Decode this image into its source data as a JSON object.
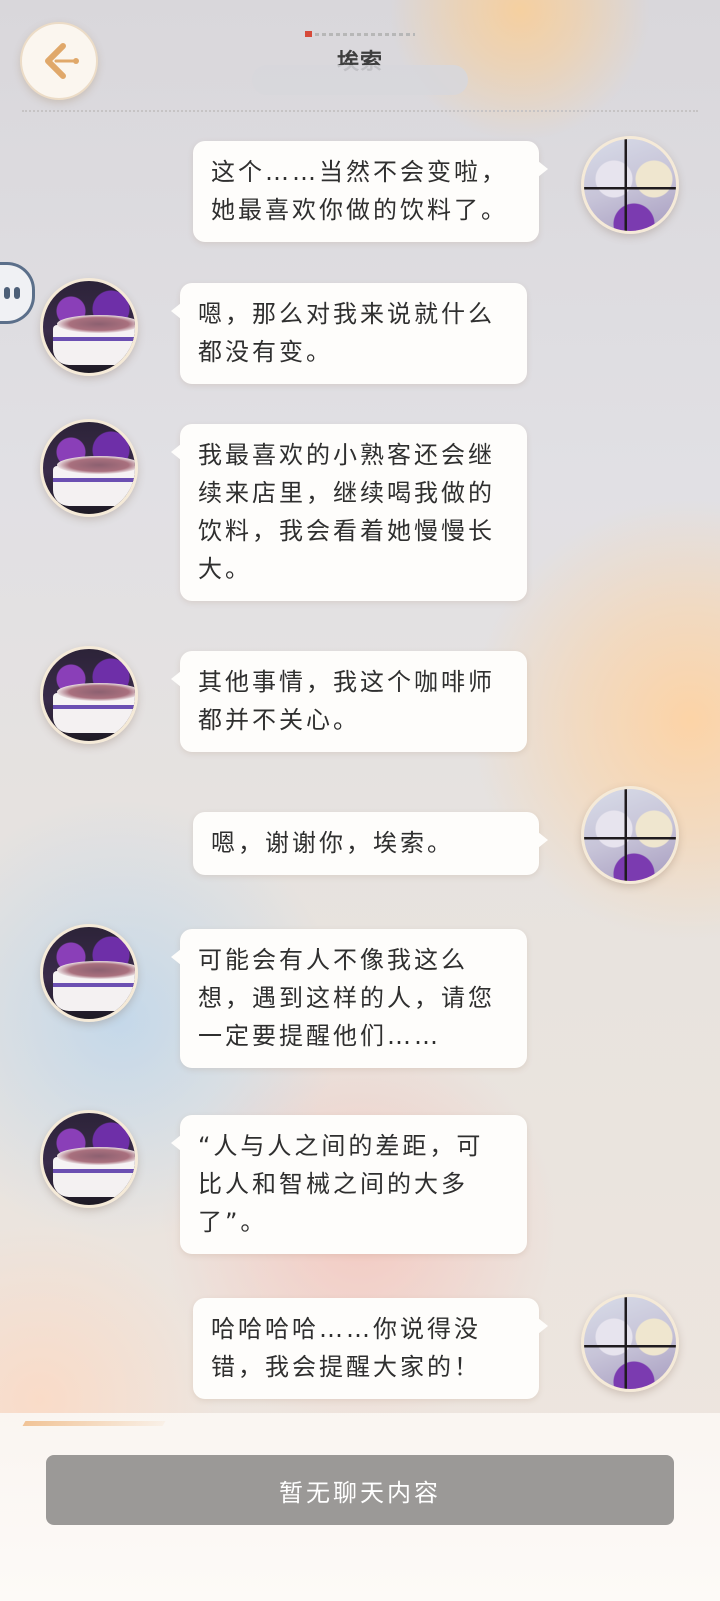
{
  "header": {
    "title": "埃索",
    "status_text": "",
    "back_icon": "chevron-left-icon"
  },
  "colors": {
    "bubble": "#fefdfb",
    "button": "#9b9997",
    "title": "#3e3e3e"
  },
  "messages": [
    {
      "side": "user",
      "text": "这个……当然不会变啦，她最喜欢你做的饮料了。"
    },
    {
      "side": "npc",
      "text": "嗯，那么对我来说就什么都没有变。"
    },
    {
      "side": "npc",
      "text": "我最喜欢的小熟客还会继续来店里，继续喝我做的饮料，我会看着她慢慢长大。"
    },
    {
      "side": "npc",
      "text": "其他事情，我这个咖啡师都并不关心。"
    },
    {
      "side": "user",
      "text": "嗯，谢谢你，埃索。"
    },
    {
      "side": "npc",
      "text": "可能会有人不像我这么想，遇到这样的人，请您一定要提醒他们……"
    },
    {
      "side": "npc",
      "text": "“人与人之间的差距，可比人和智械之间的大多了”。"
    },
    {
      "side": "user",
      "text": "哈哈哈哈……你说得没错，我会提醒大家的！"
    }
  ],
  "footer": {
    "button_label": "暂无聊天内容"
  }
}
